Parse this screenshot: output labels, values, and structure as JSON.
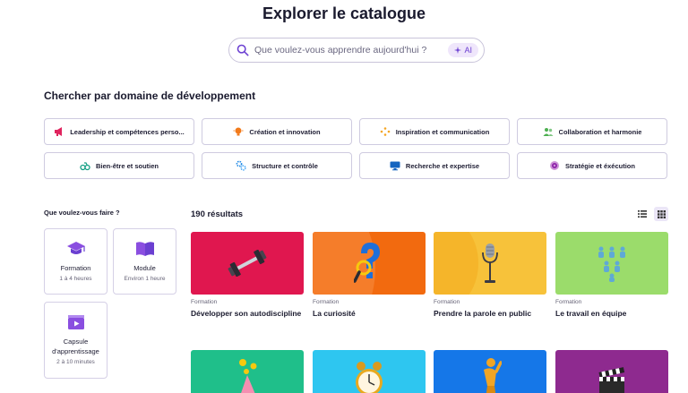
{
  "page": {
    "title": "Explorer le catalogue"
  },
  "search": {
    "placeholder": "Que voulez-vous apprendre aujourd'hui ?",
    "value": "",
    "ai_label": "AI"
  },
  "domains_section": {
    "title": "Chercher par domaine de développement",
    "items": [
      {
        "label": "Leadership et compétences perso...",
        "icon": "megaphone-icon",
        "color": "#e0245e"
      },
      {
        "label": "Création et innovation",
        "icon": "lightbulb-icon",
        "color": "#f27a1a"
      },
      {
        "label": "Inspiration et communication",
        "icon": "sparkle-icon",
        "color": "#f5a623"
      },
      {
        "label": "Collaboration et harmonie",
        "icon": "people-icon",
        "color": "#4caf50"
      },
      {
        "label": "Bien-être et soutien",
        "icon": "scale-icon",
        "color": "#16a085"
      },
      {
        "label": "Structure et contrôle",
        "icon": "gears-icon",
        "color": "#1e88e5"
      },
      {
        "label": "Recherche et expertise",
        "icon": "monitor-icon",
        "color": "#1565c0"
      },
      {
        "label": "Stratégie et éxécution",
        "icon": "target-icon",
        "color": "#8e24aa"
      }
    ]
  },
  "filters": {
    "title": "Que voulez-vous faire ?",
    "items": [
      {
        "name": "Formation",
        "duration": "1 à 4 heures",
        "icon": "graduation-cap-icon"
      },
      {
        "name": "Module",
        "duration": "Environ 1 heure",
        "icon": "book-icon"
      },
      {
        "name": "Capsule d'apprentissage",
        "duration": "2 à 10 minutes",
        "icon": "video-clip-icon"
      }
    ]
  },
  "results": {
    "count_label": "190 résultats",
    "cards": [
      {
        "type": "Formation",
        "title": "Développer son autodiscipline",
        "bg": "#e0174f",
        "icon": "dumbbell-icon"
      },
      {
        "type": "Formation",
        "title": "La curiosité",
        "bg": "#f26a0f",
        "icon": "question-magnifier-icon"
      },
      {
        "type": "Formation",
        "title": "Prendre la parole en public",
        "bg": "#f7c23a",
        "icon": "microphone-icon"
      },
      {
        "type": "Formation",
        "title": "Le travail en équipe",
        "bg": "#9bdc6b",
        "icon": "figures-icon"
      }
    ],
    "cards_row2": [
      {
        "bg": "#1fbf8a",
        "icon": "party-hat-icon"
      },
      {
        "bg": "#2ec6f0",
        "icon": "alarm-clock-icon"
      },
      {
        "bg": "#1577e8",
        "icon": "trophy-figure-icon"
      },
      {
        "bg": "#8e2a8f",
        "icon": "clapperboard-icon"
      }
    ]
  }
}
